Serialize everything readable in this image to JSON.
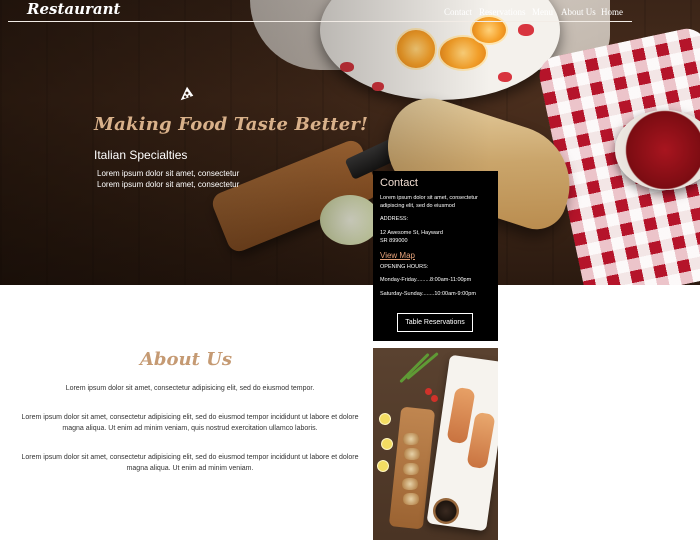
{
  "brand": "Restaurant",
  "nav": {
    "items": [
      {
        "label": "Contact"
      },
      {
        "label": "Reservations"
      },
      {
        "label": "Menu"
      },
      {
        "label": "About Us"
      },
      {
        "label": "Home"
      }
    ]
  },
  "hero": {
    "icon": "pizza-slice-icon",
    "title": "Making Food Taste Better!",
    "subtitle": "Italian Specialties",
    "lines": [
      "Lorem ipsum dolor sit amet, consectetur",
      "Lorem ipsum dolor sit amet, consectetur"
    ]
  },
  "contact": {
    "title": "Contact",
    "intro": "Lorem ipsum dolor sit amet, consectetur adipiscing elit, sed do eiusmod",
    "address_label": "ADDRESS:",
    "address_line1": "12 Awesome St, Hayward",
    "address_line2": "SR 899000",
    "map_link": "View Map",
    "hours_label": "OPENING HOURS:",
    "hours_weekday": "Monday-Friday.........8:00am-11:00pm",
    "hours_weekend": "Saturday-Sunday........10:00am-9:00pm",
    "button": "Table Reservations"
  },
  "about": {
    "title": "About Us",
    "paragraphs": [
      "Lorem ipsum dolor sit amet, consectetur adipisicing elit, sed do eiusmod tempor.",
      "Lorem ipsum dolor sit amet, consectetur adipisicing elit, sed do eiusmod tempor incididunt ut labore et dolore magna aliqua. Ut enim ad minim veniam, quis nostrud exercitation ullamco laboris.",
      "Lorem ipsum dolor sit amet, consectetur adipisicing elit, sed do eiusmod tempor incididunt ut labore et dolore magna aliqua. Ut enim ad minim veniam."
    ]
  },
  "colors": {
    "accent": "#c59a73",
    "link": "#e5a27a",
    "card_bg": "#000000"
  }
}
